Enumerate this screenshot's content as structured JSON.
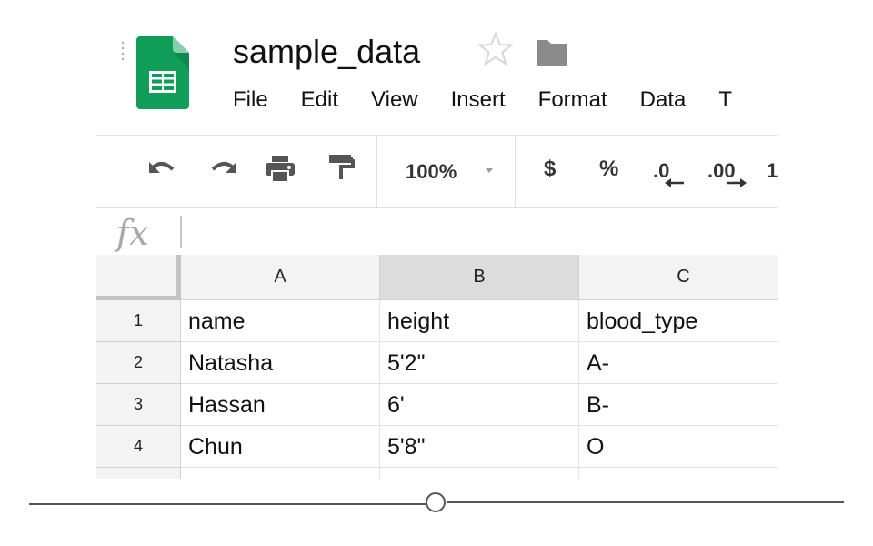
{
  "header": {
    "title": "sample_data",
    "menu": [
      "File",
      "Edit",
      "View",
      "Insert",
      "Format",
      "Data",
      "T"
    ]
  },
  "toolbar": {
    "zoom": "100%",
    "currency": "$",
    "percent": "%",
    "dec_less": ".0",
    "dec_more": ".00",
    "more_formats": "1"
  },
  "formula_bar": {
    "fx": "fx",
    "value": ""
  },
  "sheet": {
    "columns": [
      "A",
      "B",
      "C"
    ],
    "selected_column": "B",
    "rows": [
      {
        "num": "1",
        "cells": [
          "name",
          "height",
          "blood_type"
        ]
      },
      {
        "num": "2",
        "cells": [
          "Natasha",
          "5'2\"",
          "A-"
        ]
      },
      {
        "num": "3",
        "cells": [
          "Hassan",
          "6'",
          "B-"
        ]
      },
      {
        "num": "4",
        "cells": [
          "Chun",
          "5'8\"",
          "O"
        ]
      }
    ]
  },
  "colors": {
    "sheets_green": "#0f9d58",
    "selected_header": "#dcdcdc",
    "header_bg": "#f3f3f3"
  }
}
